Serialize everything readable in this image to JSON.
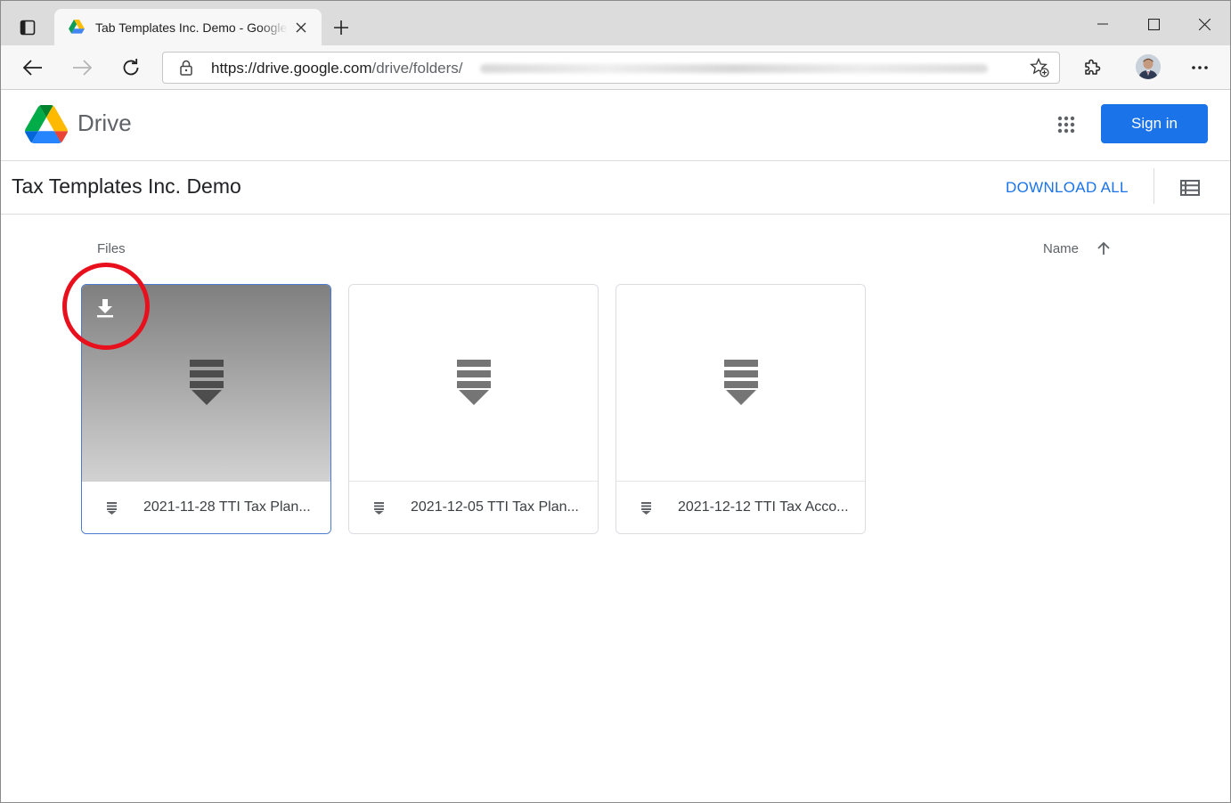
{
  "browser": {
    "tab_title": "Tab Templates Inc. Demo - Google Drive",
    "url_host": "https://drive.google.com",
    "url_path": "/drive/folders/",
    "new_tab_symbol": "+"
  },
  "header": {
    "brand": "Drive",
    "signin_label": "Sign in"
  },
  "folder": {
    "title": "Tax Templates Inc. Demo",
    "download_all_label": "DOWNLOAD ALL"
  },
  "files_section": {
    "label": "Files",
    "sort_label": "Name",
    "sort_direction": "ascending"
  },
  "files": [
    {
      "name": "2021-11-28 TTI Tax Plan...",
      "selected": true
    },
    {
      "name": "2021-12-05 TTI Tax Plan...",
      "selected": false
    },
    {
      "name": "2021-12-12 TTI Tax Acco...",
      "selected": false
    }
  ],
  "colors": {
    "accent": "#1a73e8",
    "highlight": "#e8101c",
    "selected_border": "#4a7bd0"
  },
  "icons": [
    "tab-actions-icon",
    "drive-favicon",
    "close-icon",
    "plus-icon",
    "minimize-icon",
    "maximize-icon",
    "window-close-icon",
    "back-arrow-icon",
    "forward-arrow-icon",
    "reload-icon",
    "lock-icon",
    "favorites-star-icon",
    "extensions-icon",
    "more-menu-icon",
    "google-apps-icon",
    "list-view-icon",
    "sort-up-arrow-icon",
    "download-icon",
    "binary-file-icon"
  ]
}
